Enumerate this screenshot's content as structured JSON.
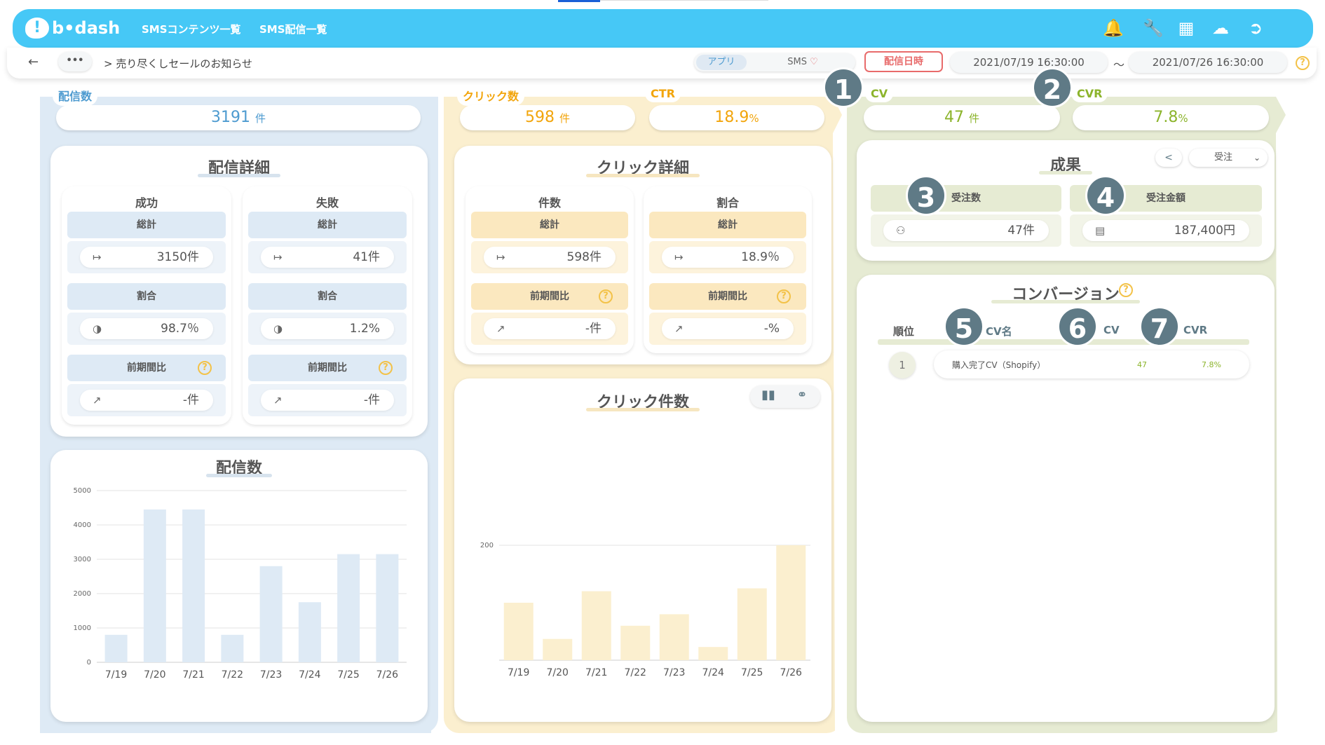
{
  "header": {
    "logo_text": "b•dash",
    "nav": [
      "SMSコンテンツ一覧",
      "SMS配信一覧"
    ],
    "icons": [
      "bell-icon",
      "wrench-icon",
      "grid-icon",
      "chat-icon",
      "logout-icon"
    ]
  },
  "subbar": {
    "back": "←",
    "more": "•••",
    "breadcrumb": "> 売り尽くしセールのお知らせ",
    "toggle_app": "アプリ",
    "toggle_sms": "SMS",
    "date_label": "配信日時",
    "date_from": "2021/07/19 16:30:00",
    "date_sep": "〜",
    "date_to": "2021/07/26 16:30:00",
    "help": "?"
  },
  "col1": {
    "tab": "配信数",
    "metric_value": "3191",
    "metric_unit": "件",
    "detail_title": "配信詳細",
    "success": {
      "title": "成功",
      "total_label": "総計",
      "total_value": "3150件",
      "ratio_label": "割合",
      "ratio_value": "98.7％",
      "prev_label": "前期間比",
      "prev_value": "-件"
    },
    "fail": {
      "title": "失敗",
      "total_label": "総計",
      "total_value": "41件",
      "ratio_label": "割合",
      "ratio_value": "1.2%",
      "prev_label": "前期間比",
      "prev_value": "-件"
    },
    "chart_title": "配信数"
  },
  "col2": {
    "tab_click": "クリック数",
    "click_value": "598",
    "click_unit": "件",
    "tab_ctr": "CTR",
    "ctr_value": "18.9",
    "ctr_unit": "%",
    "detail_title": "クリック詳細",
    "count": {
      "title": "件数",
      "total_label": "総計",
      "total_value": "598件",
      "prev_label": "前期間比",
      "prev_value": "-件"
    },
    "ratio": {
      "title": "割合",
      "total_label": "総計",
      "total_value": "18.9％",
      "prev_label": "前期間比",
      "prev_value": "-%"
    },
    "chart_title": "クリック件数"
  },
  "col3": {
    "tab_cv": "CV",
    "cv_value": "47",
    "cv_unit": "件",
    "tab_cvr": "CVR",
    "cvr_value": "7.8",
    "cvr_unit": "%",
    "result_title": "成果",
    "share_icon": "<",
    "select_value": "受注",
    "orders_label": "受注数",
    "orders_value": "47件",
    "amount_label": "受注金額",
    "amount_value": "187,400円",
    "conv_title": "コンバージョン",
    "table_headers": [
      "順位",
      "CV名",
      "CV",
      "CVR"
    ],
    "table_rows": [
      {
        "rank": "1",
        "name": "購入完了CV（Shopify）",
        "cv": "47",
        "cvr": "7.8%"
      }
    ]
  },
  "badges": [
    "1",
    "2",
    "3",
    "4",
    "5",
    "6",
    "7"
  ],
  "colors": {
    "blue": "#46c8f6",
    "blue_band": "#deeaf5",
    "yellow_band": "#fbefcf",
    "green_band": "#e6ebd3",
    "badge": "#5f7a86",
    "green_text": "#8cb42c",
    "orange_text": "#f2a50c",
    "blue_text": "#4e9bd0"
  },
  "chart_data": [
    {
      "type": "bar",
      "title": "配信数",
      "categories": [
        "7/19",
        "7/20",
        "7/21",
        "7/22",
        "7/23",
        "7/24",
        "7/25",
        "7/26"
      ],
      "values": [
        800,
        4450,
        4450,
        800,
        2800,
        1750,
        3150,
        3150
      ],
      "ylim": [
        0,
        5000
      ],
      "yticks": [
        0,
        1000,
        2000,
        3000,
        4000,
        5000
      ],
      "grid": true
    },
    {
      "type": "bar",
      "title": "クリック件数",
      "categories": [
        "7/19",
        "7/20",
        "7/21",
        "7/22",
        "7/23",
        "7/24",
        "7/25",
        "7/26"
      ],
      "values": [
        100,
        37,
        120,
        60,
        80,
        23,
        125,
        200
      ],
      "ylim": [
        0,
        200
      ],
      "yticks": [
        200
      ],
      "grid": true
    }
  ]
}
